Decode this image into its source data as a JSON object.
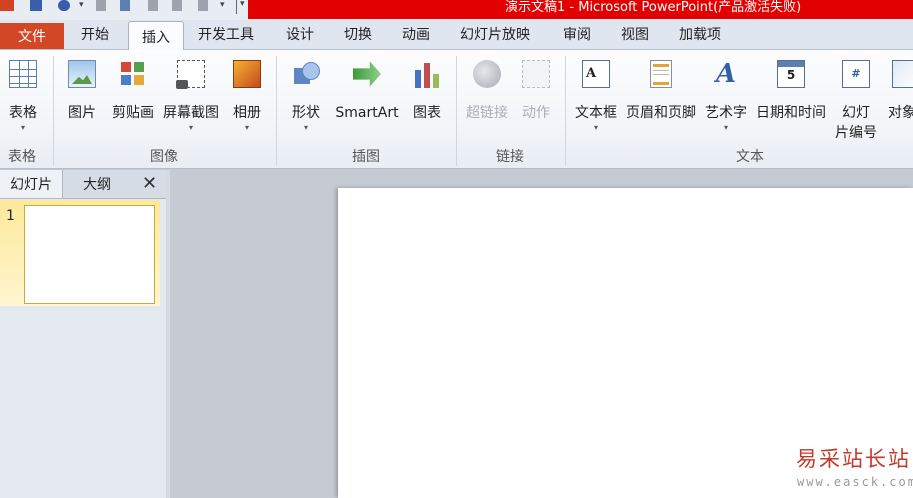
{
  "window": {
    "title": "演示文稿1 - Microsoft PowerPoint(产品激活失败)"
  },
  "tabs": [
    {
      "label": "文件"
    },
    {
      "label": "开始"
    },
    {
      "label": "插入"
    },
    {
      "label": "开发工具"
    },
    {
      "label": "设计"
    },
    {
      "label": "切换"
    },
    {
      "label": "动画"
    },
    {
      "label": "幻灯片放映"
    },
    {
      "label": "审阅"
    },
    {
      "label": "视图"
    },
    {
      "label": "加载项"
    }
  ],
  "active_tab": "插入",
  "ribbon": {
    "groups": [
      {
        "label": "表格",
        "buttons": [
          {
            "label": "表格",
            "icon": "table-icon",
            "dropdown": true
          }
        ]
      },
      {
        "label": "图像",
        "buttons": [
          {
            "label": "图片",
            "icon": "picture-icon"
          },
          {
            "label": "剪贴画",
            "icon": "clip-art-icon"
          },
          {
            "label": "屏幕截图",
            "icon": "screenshot-icon",
            "dropdown": true
          },
          {
            "label": "相册",
            "icon": "photo-album-icon",
            "dropdown": true
          }
        ]
      },
      {
        "label": "插图",
        "buttons": [
          {
            "label": "形状",
            "icon": "shapes-icon",
            "dropdown": true
          },
          {
            "label": "SmartArt",
            "icon": "smartart-icon"
          },
          {
            "label": "图表",
            "icon": "chart-icon"
          }
        ]
      },
      {
        "label": "链接",
        "buttons": [
          {
            "label": "超链接",
            "icon": "hyperlink-icon",
            "disabled": true
          },
          {
            "label": "动作",
            "icon": "action-icon",
            "disabled": true
          }
        ]
      },
      {
        "label": "文本",
        "buttons": [
          {
            "label": "文本框",
            "icon": "text-box-icon",
            "dropdown": true
          },
          {
            "label": "页眉和页脚",
            "icon": "header-footer-icon"
          },
          {
            "label": "艺术字",
            "icon": "wordart-icon",
            "dropdown": true
          },
          {
            "label": "日期和时间",
            "icon": "date-time-icon"
          },
          {
            "label": "幻灯\n片编号",
            "icon": "slide-number-icon"
          },
          {
            "label": "对象",
            "icon": "object-icon"
          }
        ]
      }
    ],
    "icon_glyphs": {
      "text_box": "A",
      "wordart": "A",
      "date_time": "5",
      "slide_number": "#"
    }
  },
  "left_pane": {
    "tabs": [
      {
        "label": "幻灯片"
      },
      {
        "label": "大纲"
      }
    ],
    "close_glyph": "✕",
    "slides": [
      {
        "number": "1"
      }
    ]
  },
  "watermark": {
    "logo_text": "易采站长站",
    "url": "www.easck.com"
  },
  "colors": {
    "file_tab": "#d24726",
    "title_bar": "#e20000",
    "selected_thumbnail": "#fde99a"
  }
}
